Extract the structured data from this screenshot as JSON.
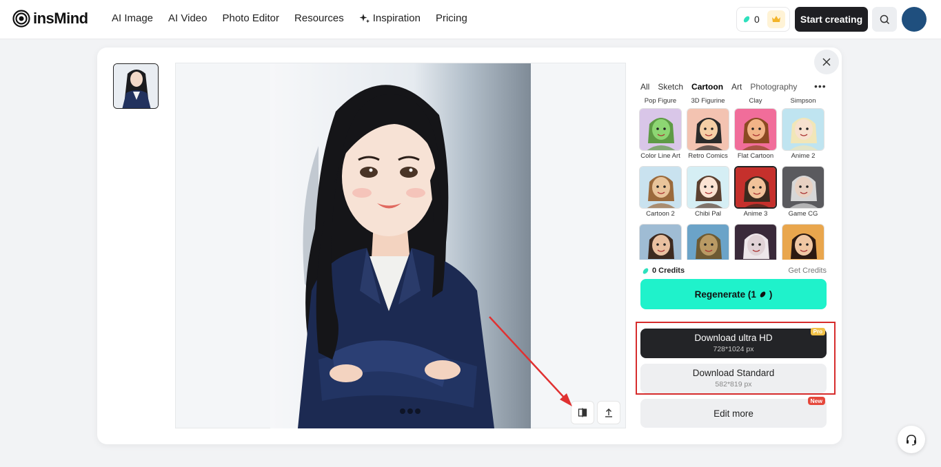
{
  "brand": {
    "name": "insMind"
  },
  "nav": {
    "links": [
      "AI Image",
      "AI Video",
      "Photo Editor",
      "Resources",
      "Inspiration",
      "Pricing"
    ],
    "credit_count": "0",
    "start_label": "Start creating"
  },
  "styles": {
    "tabs": [
      "All",
      "Sketch",
      "Cartoon",
      "Art",
      "Photography"
    ],
    "active_tab": "Cartoon",
    "top_labels": [
      "Pop Figure",
      "3D Figurine",
      "Clay",
      "Simpson"
    ],
    "items": [
      {
        "label": "Color Line Art",
        "bg": "#d9c6e8",
        "face": "#8dd673",
        "hair": "#5e9b45"
      },
      {
        "label": "Retro Comics",
        "bg": "#f3c3b1",
        "face": "#f5cfa5",
        "hair": "#2a2a2a"
      },
      {
        "label": "Flat Cartoon",
        "bg": "#f16d9a",
        "face": "#f2b487",
        "hair": "#8b4a22"
      },
      {
        "label": "Anime 2",
        "bg": "#bfe4f0",
        "face": "#f7e1cf",
        "hair": "#f1e6b8"
      },
      {
        "label": "Cartoon 2",
        "bg": "#c9e2ef",
        "face": "#e9c49a",
        "hair": "#9b6a3c"
      },
      {
        "label": "Chibi Pal",
        "bg": "#d5eef4",
        "face": "#fbe3d3",
        "hair": "#5b4030"
      },
      {
        "label": "Anime 3",
        "bg": "#c5302c",
        "face": "#f1c29a",
        "hair": "#3a2a1e"
      },
      {
        "label": "Game CG",
        "bg": "#5a5a5e",
        "face": "#e8d1c2",
        "hair": "#d7d7d7"
      },
      {
        "label": "",
        "bg": "#9fbcd4",
        "face": "#e9c0a0",
        "hair": "#3d2a20"
      },
      {
        "label": "",
        "bg": "#6ba3c8",
        "face": "#b99a64",
        "hair": "#6d5a33"
      },
      {
        "label": "",
        "bg": "#3a2a3a",
        "face": "#e0d2d6",
        "hair": "#ede6ea"
      },
      {
        "label": "",
        "bg": "#e9a64d",
        "face": "#f0c7a3",
        "hair": "#2c1a12"
      }
    ]
  },
  "credits": {
    "label": "0 Credits",
    "get": "Get Credits"
  },
  "regenerate": {
    "label": "Regenerate (1",
    "suffix": ")"
  },
  "download_hd": {
    "label": "Download ultra HD",
    "size": "728*1024 px",
    "badge": "Pro"
  },
  "download_std": {
    "label": "Download Standard",
    "size": "582*819 px"
  },
  "edit": {
    "label": "Edit more",
    "badge": "New"
  },
  "colors": {
    "accent": "#1ff2cb",
    "highlight": "#d62b2b",
    "dark": "#232427"
  }
}
